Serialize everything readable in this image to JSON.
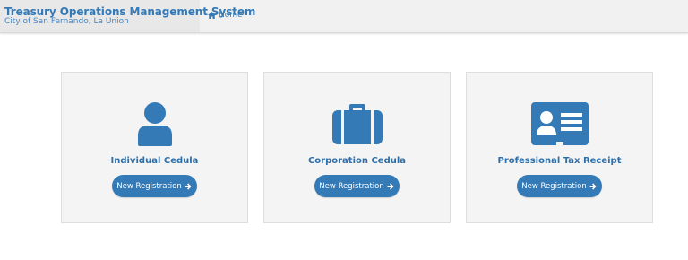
{
  "header": {
    "title": "Treasury Operations Management System",
    "subtitle": "City of San Fernando, La Union",
    "home_label": "Home"
  },
  "cards": [
    {
      "title": "Individual Cedula",
      "button_label": "New Registration",
      "icon": "user-icon"
    },
    {
      "title": "Corporation Cedula",
      "button_label": "New Registration",
      "icon": "briefcase-icon"
    },
    {
      "title": "Professional Tax Receipt",
      "button_label": "New Registration",
      "icon": "id-card-icon"
    }
  ],
  "colors": {
    "accent": "#337ab7",
    "navbar_bg": "#f1f1f1",
    "card_bg": "#f4f4f4"
  }
}
